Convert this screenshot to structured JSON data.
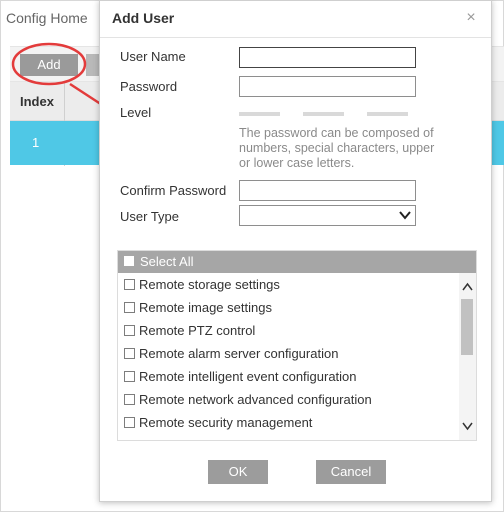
{
  "background": {
    "breadcrumb": "Config Home",
    "toolbar": {
      "add_label": "Add"
    },
    "table": {
      "headers": [
        "Index"
      ],
      "rows": [
        [
          "1"
        ]
      ],
      "selected_row_color": "#4fc8e6"
    }
  },
  "annotation": {
    "color": "#e33b3b"
  },
  "dialog": {
    "title": "Add User",
    "close_glyph": "×",
    "fields": {
      "username": {
        "label": "User Name",
        "value": ""
      },
      "password": {
        "label": "Password",
        "value": ""
      },
      "level": {
        "label": "Level"
      },
      "password_hint": "The password can be composed of numbers, special characters, upper or lower case letters.",
      "confirm_password": {
        "label": "Confirm Password",
        "value": ""
      },
      "user_type": {
        "label": "User Type",
        "selected": ""
      }
    },
    "permissions": {
      "select_all_label": "Select All",
      "items": [
        {
          "label": "Remote storage settings",
          "checked": false
        },
        {
          "label": "Remote image settings",
          "checked": false
        },
        {
          "label": "Remote PTZ control",
          "checked": false
        },
        {
          "label": "Remote alarm server configuration",
          "checked": false
        },
        {
          "label": "Remote intelligent event configuration",
          "checked": false
        },
        {
          "label": "Remote network advanced configuration",
          "checked": false
        },
        {
          "label": "Remote security management",
          "checked": false
        }
      ]
    },
    "buttons": {
      "ok_label": "OK",
      "cancel_label": "Cancel"
    }
  },
  "colors": {
    "button_gray": "#9c9c9c",
    "header_gray": "#a6a6a6",
    "accent": "#4fc8e6"
  }
}
